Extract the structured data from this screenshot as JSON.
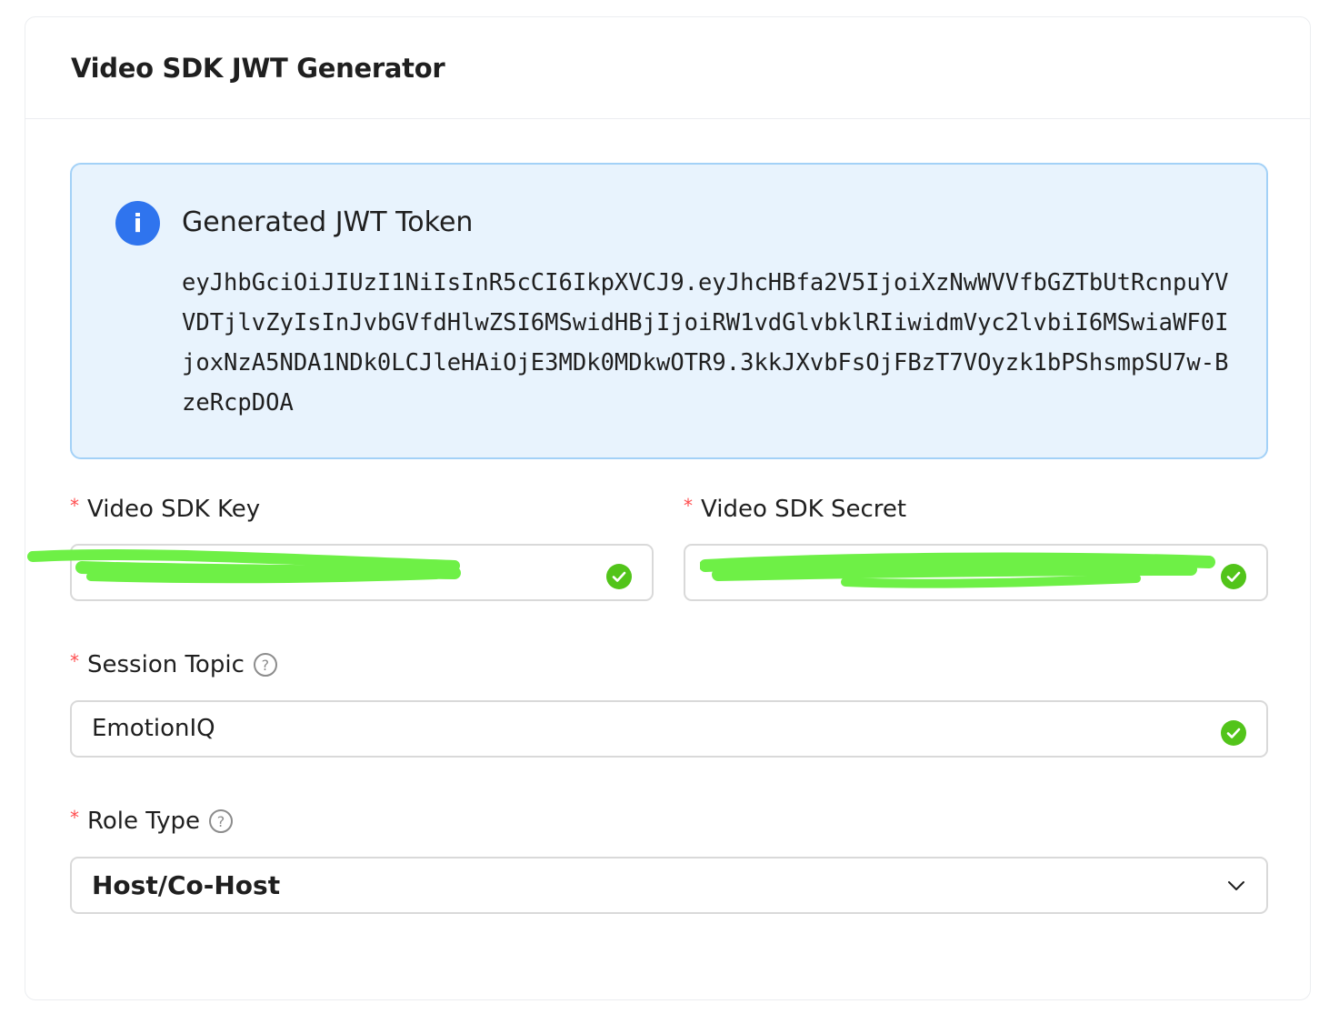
{
  "card": {
    "title": "Video SDK JWT Generator"
  },
  "alert": {
    "icon": "info-icon",
    "title": "Generated JWT Token",
    "token": "eyJhbGciOiJIUzI1NiIsInR5cCI6IkpXVCJ9.eyJhcHBfa2V5IjoiXzNwWVVfbGZTbUtRcnpuYVVDTjlvZyIsInJvbGVfdHlwZSI6MSwidHBjIjoiRW1vdGlvbklRIiwidmVyc2lvbiI6MSwiaWF0IjoxNzA5NDA1NDk0LCJleHAiOjE3MDk0MDkwOTR9.3kkJXvbFsOjFBzT7VOyzk1bPShsmpSU7w-BzeRcpDOA",
    "accent_color": "#2f74ee"
  },
  "form": {
    "required_mark": "*",
    "sdk_key": {
      "label": "Video SDK Key",
      "value": "",
      "status": "success"
    },
    "sdk_secret": {
      "label": "Video SDK Secret",
      "value": "",
      "status": "success"
    },
    "session_topic": {
      "label": "Session Topic",
      "value": "EmotionIQ",
      "status": "success",
      "help_icon": "question-circle-icon"
    },
    "role_type": {
      "label": "Role Type",
      "selected": "Host/Co-Host",
      "help_icon": "question-circle-icon"
    }
  },
  "colors": {
    "success": "#52c41a",
    "required": "#ff4d4f",
    "alert_bg": "#e8f3fd",
    "alert_border": "#a3d1f7",
    "redaction": "#6ef046"
  }
}
